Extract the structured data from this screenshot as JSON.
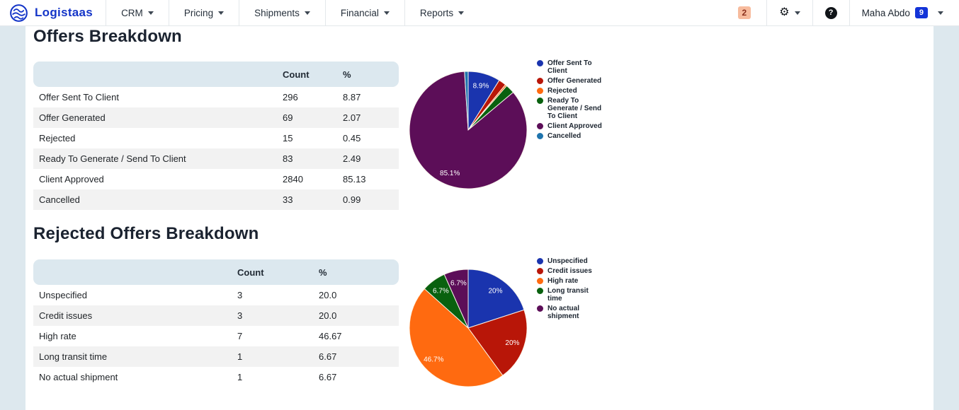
{
  "header": {
    "brand": "Logistaas",
    "nav": [
      {
        "label": "CRM"
      },
      {
        "label": "Pricing"
      },
      {
        "label": "Shipments"
      },
      {
        "label": "Financial"
      },
      {
        "label": "Reports"
      }
    ],
    "notification_count": "2",
    "help_label": "?",
    "user": {
      "name": "Maha Abdo",
      "badge": "9"
    }
  },
  "colors": {
    "brand_blue": "#1435c8",
    "page_gutter": "#dde8ee",
    "table_header_bg": "#dce8ef",
    "row_stripe": "#f2f2f2",
    "pie_palette": [
      "#1a34ae",
      "#b81608",
      "#ff6a10",
      "#09610f",
      "#5c0e58",
      "#1f74ad"
    ]
  },
  "sections": [
    {
      "title": "Offers Breakdown",
      "chart_index": 0,
      "table": {
        "columns": [
          "Count",
          "%"
        ],
        "rows": [
          [
            "Offer Sent To Client",
            "296",
            "8.87"
          ],
          [
            "Offer Generated",
            "69",
            "2.07"
          ],
          [
            "Rejected",
            "15",
            "0.45"
          ],
          [
            "Ready To Generate / Send To Client",
            "83",
            "2.49"
          ],
          [
            "Client Approved",
            "2840",
            "85.13"
          ],
          [
            "Cancelled",
            "33",
            "0.99"
          ]
        ]
      }
    },
    {
      "title": "Rejected Offers Breakdown",
      "chart_index": 1,
      "table": {
        "columns": [
          "Count",
          "%"
        ],
        "rows": [
          [
            "Unspecified",
            "3",
            "20.0"
          ],
          [
            "Credit issues",
            "3",
            "20.0"
          ],
          [
            "High rate",
            "7",
            "46.67"
          ],
          [
            "Long transit time",
            "1",
            "6.67"
          ],
          [
            "No actual shipment",
            "1",
            "6.67"
          ]
        ]
      }
    }
  ],
  "chart_data": [
    {
      "type": "pie",
      "title": "Offers Breakdown",
      "categories": [
        "Offer Sent To Client",
        "Offer Generated",
        "Rejected",
        "Ready To Generate / Send To Client",
        "Client Approved",
        "Cancelled"
      ],
      "values": [
        8.87,
        2.07,
        0.45,
        2.49,
        85.13,
        0.99
      ],
      "counts": [
        296,
        69,
        15,
        83,
        2840,
        33
      ],
      "colors": [
        "#1a34ae",
        "#b81608",
        "#ff6a10",
        "#09610f",
        "#5c0e58",
        "#1f74ad"
      ],
      "slice_labels": [
        "8.9%",
        "",
        "",
        "",
        "85.1%",
        ""
      ],
      "legend_position": "right",
      "start_angle_deg": 0,
      "direction": "clockwise"
    },
    {
      "type": "pie",
      "title": "Rejected Offers Breakdown",
      "categories": [
        "Unspecified",
        "Credit issues",
        "High rate",
        "Long transit time",
        "No actual shipment"
      ],
      "values": [
        20.0,
        20.0,
        46.67,
        6.67,
        6.67
      ],
      "counts": [
        3,
        3,
        7,
        1,
        1
      ],
      "colors": [
        "#1a34ae",
        "#b81608",
        "#ff6a10",
        "#09610f",
        "#5c0e58"
      ],
      "slice_labels": [
        "20%",
        "20%",
        "46.7%",
        "6.7%",
        "6.7%"
      ],
      "legend_position": "right",
      "start_angle_deg": 0,
      "direction": "clockwise"
    }
  ]
}
